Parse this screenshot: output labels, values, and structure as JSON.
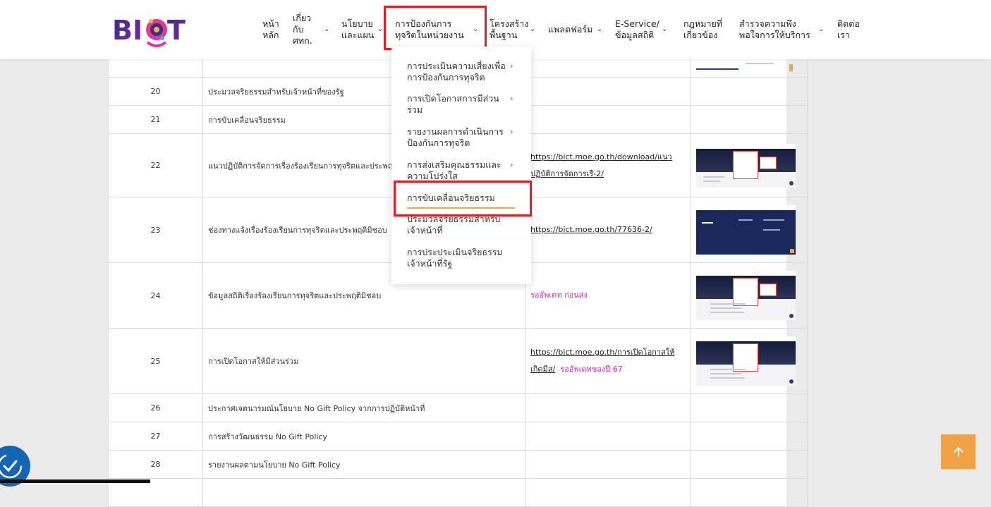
{
  "header": {
    "logo_text": "BICT",
    "nav": [
      {
        "label": "หน้า\nหลัก",
        "has_children": false
      },
      {
        "label": "เกี่ยว\nกับ\nศทก.",
        "has_children": true
      },
      {
        "label": "นโยบาย\nและแผน",
        "has_children": true
      },
      {
        "label": "การป้องกันการ\nทุจริตในหน่วยงาน",
        "has_children": true,
        "active": true
      },
      {
        "label": "โครงสร้าง\nพื้นฐาน",
        "has_children": true
      },
      {
        "label": "แพลตฟอร์ม",
        "has_children": true
      },
      {
        "label": "E-Service/\nข้อมูลสถิติ",
        "has_children": true
      },
      {
        "label": "กฎหมายที่\nเกี่ยวข้อง",
        "has_children": false
      },
      {
        "label": "สำรวจความพึง\nพอใจการให้บริการ",
        "has_children": true
      },
      {
        "label": "ติดต่อ\nเรา",
        "has_children": false
      }
    ]
  },
  "dropdown": {
    "items": [
      {
        "label": "การประเมินความเสี่ยงเพื่อการป้องกันการทุจริต",
        "has_children": true
      },
      {
        "label": "การเปิดโอกาสการมีส่วนร่วม",
        "has_children": true
      },
      {
        "label": "รายงานผลการดำเนินการป้องกันการทุจริต",
        "has_children": true
      },
      {
        "label": "การส่งเสริมคุณธรรมและความโปร่งใส",
        "has_children": true
      },
      {
        "label": "การขับเคลื่อนจริยธรรม",
        "has_children": false,
        "highlighted": true
      },
      {
        "label": "ประมวลจริยธรรมสำหรับเจ้าหน้าที่",
        "has_children": false
      },
      {
        "label": "การประประเมินจริยธรรมเจ้าหน้าที่รัฐ",
        "has_children": false
      }
    ]
  },
  "table": {
    "rows": [
      {
        "no": "",
        "title": "",
        "link": "",
        "note": "",
        "image": "partial"
      },
      {
        "no": "20",
        "title": "ประมวลจริยธรรมสำหรับเจ้าหน้าที่ของรัฐ",
        "link": "",
        "note": "",
        "image": ""
      },
      {
        "no": "21",
        "title": "การขับเคลื่อนจริยธรรม",
        "link": "",
        "note": "",
        "image": ""
      },
      {
        "no": "22",
        "title": "แนวปฏิบัติการจัดการเรื่องร้องเรียนการทุจริตและประพฤติมิชอบ",
        "link": "https://bict.moe.go.th/download/แนวปฏิบัติการจัดการเรื-2/",
        "note": "",
        "image": "screenshot"
      },
      {
        "no": "23",
        "title": "ช่องทางแจ้งเรื่องร้องเรียนการทุจริตและประพฤติมิชอบ",
        "link": "https://bict.moe.go.th/77636-2/",
        "note": "",
        "image": "navy"
      },
      {
        "no": "24",
        "title": "ข้อมูลสถิติเรื่องร้องเรียนการทุจริตและประพฤติมิชอบ",
        "link": "",
        "note": "รออัพเดท ก่อนส่ง",
        "image": "screenshot"
      },
      {
        "no": "25",
        "title": "การเปิดโอกาสให้มีส่วนร่วม",
        "link": "https://bict.moe.go.th/การเปิดโอกาสให้เกิดมีส/",
        "note": "รออัพเดทของปี 67",
        "image": "screenshot"
      },
      {
        "no": "26",
        "title": "ประกาศเจตนารมณ์นโยบาย No Gift Policy จากการปฏิบัติหน้าที่",
        "link": "",
        "note": "",
        "image": ""
      },
      {
        "no": "27",
        "title": "การสร้างวัฒนธรรม No Gift Policy",
        "link": "",
        "note": "",
        "image": ""
      },
      {
        "no": "28",
        "title": "รายงานผลตามนโยบาย No Gift Policy",
        "link": "",
        "note": "",
        "image": ""
      },
      {
        "no": "",
        "title": "",
        "link": "",
        "note": "",
        "image": ""
      }
    ]
  },
  "colors": {
    "highlight_border": "#e41d25",
    "accent_orange": "#f0a145",
    "pink_note": "#e51fd0",
    "a11y_blue": "#1466b3"
  },
  "icons": {
    "back_to_top": "arrow-up-icon",
    "accessibility": "accessibility-icon"
  }
}
